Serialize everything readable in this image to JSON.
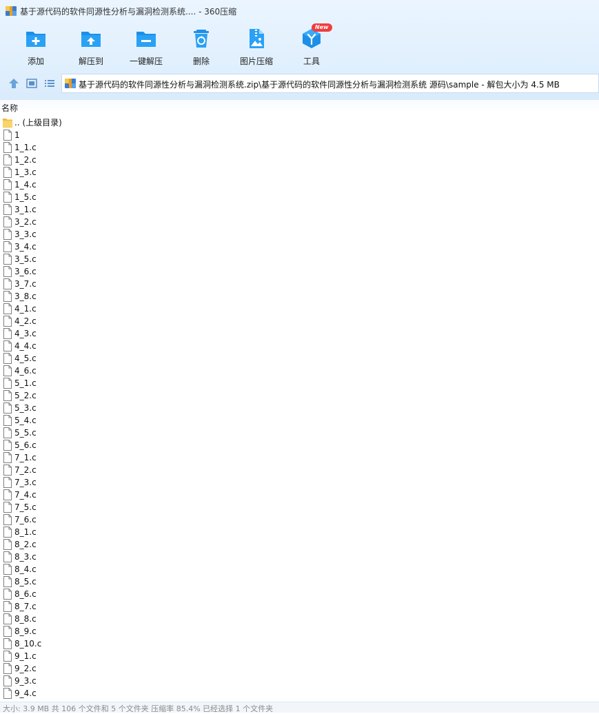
{
  "window": {
    "title": "基于源代码的软件同源性分析与漏洞检测系统.... - 360压缩"
  },
  "toolbar": {
    "add_label": "添加",
    "extract_to_label": "解压到",
    "one_click_extract_label": "一键解压",
    "delete_label": "删除",
    "image_compress_label": "图片压缩",
    "tools_label": "工具",
    "tools_badge": "New"
  },
  "address": {
    "path": "基于源代码的软件同源性分析与漏洞检测系统.zip\\基于源代码的软件同源性分析与漏洞检测系统 源码\\sample - 解包大小为 4.5 MB"
  },
  "columns": {
    "name": "名称"
  },
  "parent_dir": ".. (上级目录)",
  "files": [
    "1",
    "1_1.c",
    "1_2.c",
    "1_3.c",
    "1_4.c",
    "1_5.c",
    "3_1.c",
    "3_2.c",
    "3_3.c",
    "3_4.c",
    "3_5.c",
    "3_6.c",
    "3_7.c",
    "3_8.c",
    "4_1.c",
    "4_2.c",
    "4_3.c",
    "4_4.c",
    "4_5.c",
    "4_6.c",
    "5_1.c",
    "5_2.c",
    "5_3.c",
    "5_4.c",
    "5_5.c",
    "5_6.c",
    "7_1.c",
    "7_2.c",
    "7_3.c",
    "7_4.c",
    "7_5.c",
    "7_6.c",
    "8_1.c",
    "8_2.c",
    "8_3.c",
    "8_4.c",
    "8_5.c",
    "8_6.c",
    "8_7.c",
    "8_8.c",
    "8_9.c",
    "8_10.c",
    "9_1.c",
    "9_2.c",
    "9_3.c",
    "9_4.c"
  ],
  "status": {
    "text": "大小: 3.9 MB 共 106 个文件和 5 个文件夹 压缩率 85.4% 已经选择 1 个文件夹"
  },
  "colors": {
    "accent": "#1e8fe8",
    "folder": "#f7c64a",
    "badge": "#f03d3d"
  }
}
